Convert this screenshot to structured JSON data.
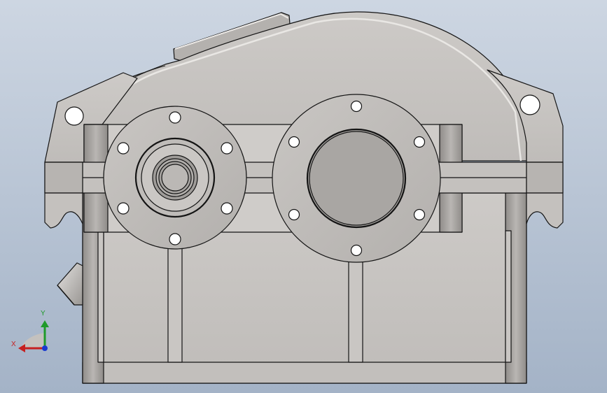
{
  "triad": {
    "x_label": "X",
    "y_label": "Y",
    "x_color": "#c62020",
    "y_color": "#1f9a2a",
    "z_color": "#1a3ad0"
  },
  "model": {
    "subject": "gearbox-housing",
    "view": "front",
    "display_style": "shaded-with-edges",
    "body_color": "#c6c3c0",
    "edge_color": "#141414",
    "background_top": "#cdd6e2",
    "background_bottom": "#a4b3c7"
  }
}
